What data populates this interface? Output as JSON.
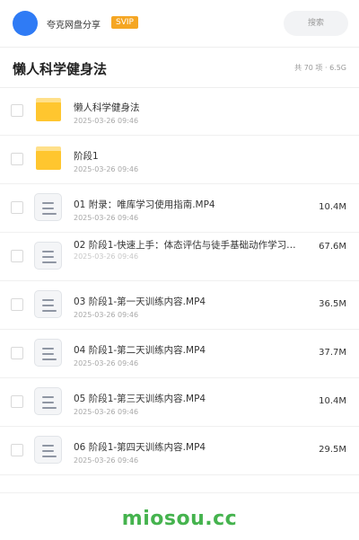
{
  "header": {
    "share_title": "夸克网盘分享",
    "badge": "SVIP",
    "search_label": "搜索"
  },
  "title_bar": {
    "title": "懒人科学健身法",
    "count": "共 70 项 · 6.5G"
  },
  "files": [
    {
      "type": "folder",
      "name": "懒人科学健身法",
      "date": "2025-03-26 09:46",
      "size": ""
    },
    {
      "type": "folder",
      "name": "阶段1",
      "date": "2025-03-26 09:46",
      "size": ""
    },
    {
      "type": "file",
      "name": "01 附录：唯库学习使用指南.MP4",
      "date": "2025-03-26 09:46",
      "size": "10.4M"
    },
    {
      "type": "file",
      "name": "02 阶段1-快速上手：体态评估与徒手基础动作学习…",
      "date": "2025-03-26 09:46",
      "size": "67.6M"
    },
    {
      "type": "file",
      "name": "03 阶段1-第一天训练内容.MP4",
      "date": "2025-03-26 09:46",
      "size": "36.5M"
    },
    {
      "type": "file",
      "name": "04 阶段1-第二天训练内容.MP4",
      "date": "2025-03-26 09:46",
      "size": "37.7M"
    },
    {
      "type": "file",
      "name": "05 阶段1-第三天训练内容.MP4",
      "date": "2025-03-26 09:46",
      "size": "10.4M"
    },
    {
      "type": "file",
      "name": "06 阶段1-第四天训练内容.MP4",
      "date": "2025-03-26 09:46",
      "size": "29.5M"
    }
  ],
  "footer": {
    "watermark": "miosou.cc"
  }
}
